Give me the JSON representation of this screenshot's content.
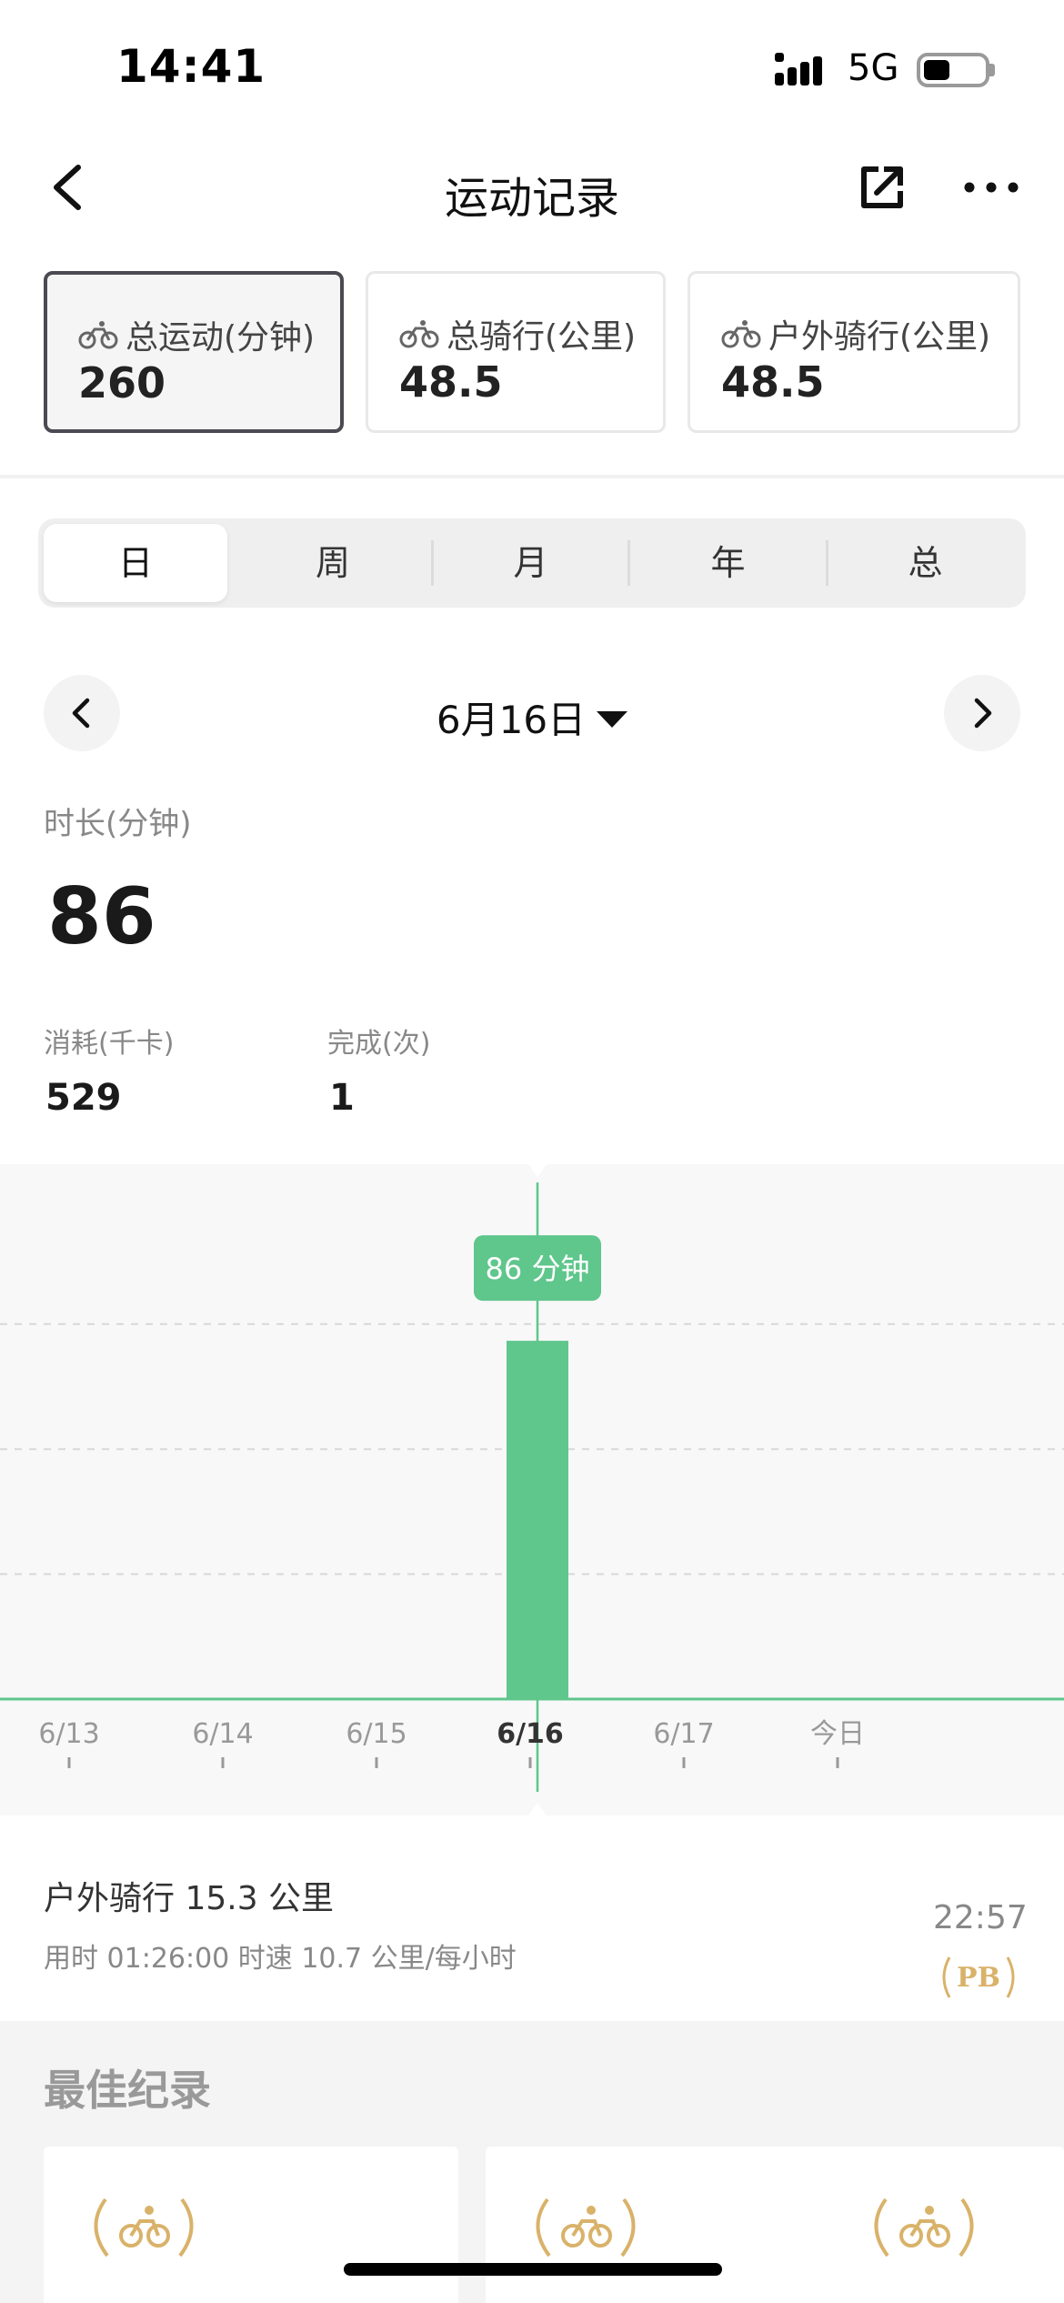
{
  "status_bar": {
    "time": "14:41",
    "network": "5G"
  },
  "nav": {
    "title": "运动记录"
  },
  "summary_cards": [
    {
      "label": "总运动(分钟)",
      "value": "260"
    },
    {
      "label": "总骑行(公里)",
      "value": "48.5"
    },
    {
      "label": "户外骑行(公里)",
      "value": "48.5"
    }
  ],
  "segments": [
    "日",
    "周",
    "月",
    "年",
    "总"
  ],
  "date": {
    "label": "6月16日"
  },
  "metrics": {
    "duration_label": "时长(分钟)",
    "duration_value": "86",
    "calories_label": "消耗(千卡)",
    "calories_value": "529",
    "completed_label": "完成(次)",
    "completed_value": "1"
  },
  "chart_data": {
    "type": "bar",
    "categories": [
      "6/13",
      "6/14",
      "6/15",
      "6/16",
      "6/17",
      "今日"
    ],
    "values": [
      0,
      0,
      0,
      86,
      0,
      0
    ],
    "selected_index": 3,
    "tooltip": "86 分钟",
    "ylim": [
      0,
      100
    ],
    "gridlines": true,
    "bar_color": "#5fc68c"
  },
  "activity": {
    "title": "户外骑行  15.3 公里",
    "details": "用时 01:26:00    时速 10.7 公里/每小时",
    "time": "22:57",
    "badge": "PB"
  },
  "best": {
    "title": "最佳纪录"
  },
  "colors": {
    "accent": "#5fc68c",
    "gold": "#d9b26a"
  }
}
